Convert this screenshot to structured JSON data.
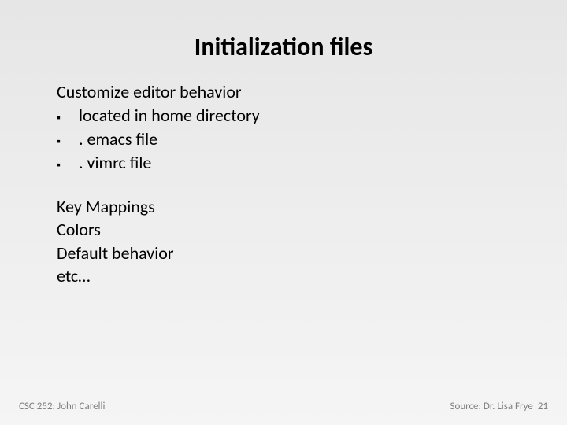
{
  "title": "Initialization files",
  "block1": {
    "intro": "Customize editor behavior",
    "bullets": [
      "located in home directory",
      ". emacs file",
      ". vimrc file"
    ]
  },
  "block2": {
    "lines": [
      "Key Mappings",
      "Colors",
      "Default behavior",
      "etc…"
    ]
  },
  "footer": {
    "left": "CSC 252: John Carelli",
    "right": "Source: Dr. Lisa Frye",
    "page": "21"
  },
  "glyphs": {
    "bullet": "▪"
  }
}
